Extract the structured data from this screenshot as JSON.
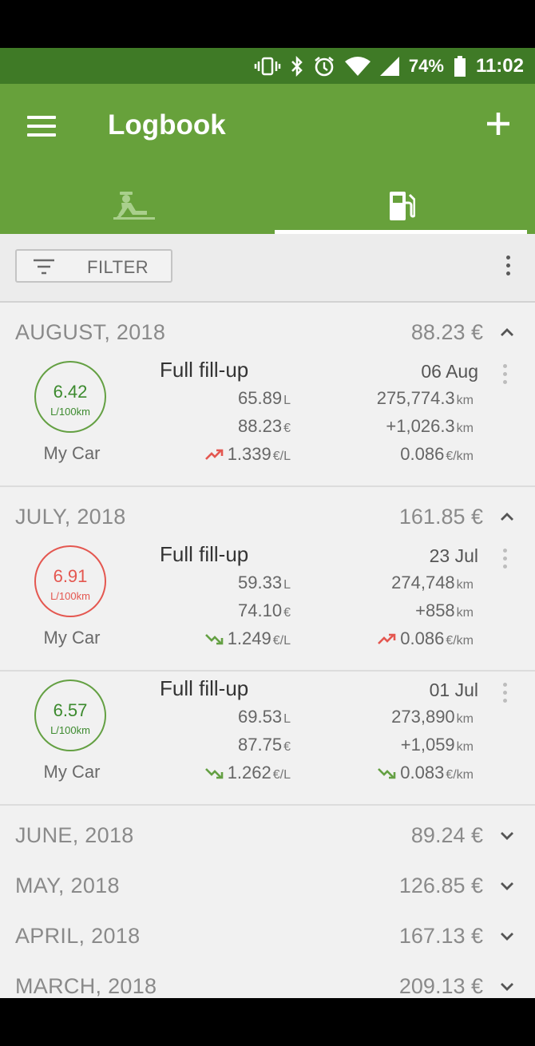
{
  "status": {
    "battery": "74%",
    "time": "11:02"
  },
  "appbar": {
    "title": "Logbook",
    "tabs": [
      {
        "icon": "trips-icon",
        "selected": false
      },
      {
        "icon": "fuel-pump-icon",
        "selected": true
      }
    ]
  },
  "toolbar": {
    "filter_label": "FILTER"
  },
  "colors": {
    "primary": "#67a13b",
    "primary_dark": "#3f7a26",
    "good": "#64a043",
    "bad": "#e45750"
  },
  "months": [
    {
      "name": "AUGUST, 2018",
      "total": "88.23 €",
      "expanded": true,
      "entries": [
        {
          "circle_value": "6.42",
          "circle_unit": "L/100km",
          "circle_status": "good",
          "car": "My Car",
          "type": "Full fill-up",
          "date": "06 Aug",
          "liters": "65.89",
          "liters_unit": "L",
          "odometer": "275,774.3",
          "odometer_unit": "km",
          "cost": "88.23",
          "cost_unit": "€",
          "distance": "+1,026.3",
          "distance_unit": "km",
          "price": "1.339",
          "price_unit": "€/L",
          "price_trend": "up",
          "cost_per_km": "0.086",
          "cost_per_km_unit": "€/km",
          "cost_per_km_trend": "none"
        }
      ]
    },
    {
      "name": "JULY, 2018",
      "total": "161.85 €",
      "expanded": true,
      "entries": [
        {
          "circle_value": "6.91",
          "circle_unit": "L/100km",
          "circle_status": "bad",
          "car": "My Car",
          "type": "Full fill-up",
          "date": "23 Jul",
          "liters": "59.33",
          "liters_unit": "L",
          "odometer": "274,748",
          "odometer_unit": "km",
          "cost": "74.10",
          "cost_unit": "€",
          "distance": "+858",
          "distance_unit": "km",
          "price": "1.249",
          "price_unit": "€/L",
          "price_trend": "down",
          "cost_per_km": "0.086",
          "cost_per_km_unit": "€/km",
          "cost_per_km_trend": "up"
        },
        {
          "circle_value": "6.57",
          "circle_unit": "L/100km",
          "circle_status": "good",
          "car": "My Car",
          "type": "Full fill-up",
          "date": "01 Jul",
          "liters": "69.53",
          "liters_unit": "L",
          "odometer": "273,890",
          "odometer_unit": "km",
          "cost": "87.75",
          "cost_unit": "€",
          "distance": "+1,059",
          "distance_unit": "km",
          "price": "1.262",
          "price_unit": "€/L",
          "price_trend": "down",
          "cost_per_km": "0.083",
          "cost_per_km_unit": "€/km",
          "cost_per_km_trend": "down"
        }
      ]
    },
    {
      "name": "JUNE, 2018",
      "total": "89.24 €",
      "expanded": false,
      "entries": []
    },
    {
      "name": "MAY, 2018",
      "total": "126.85 €",
      "expanded": false,
      "entries": []
    },
    {
      "name": "APRIL, 2018",
      "total": "167.13 €",
      "expanded": false,
      "entries": []
    },
    {
      "name": "MARCH, 2018",
      "total": "209.13 €",
      "expanded": false,
      "entries": []
    }
  ]
}
